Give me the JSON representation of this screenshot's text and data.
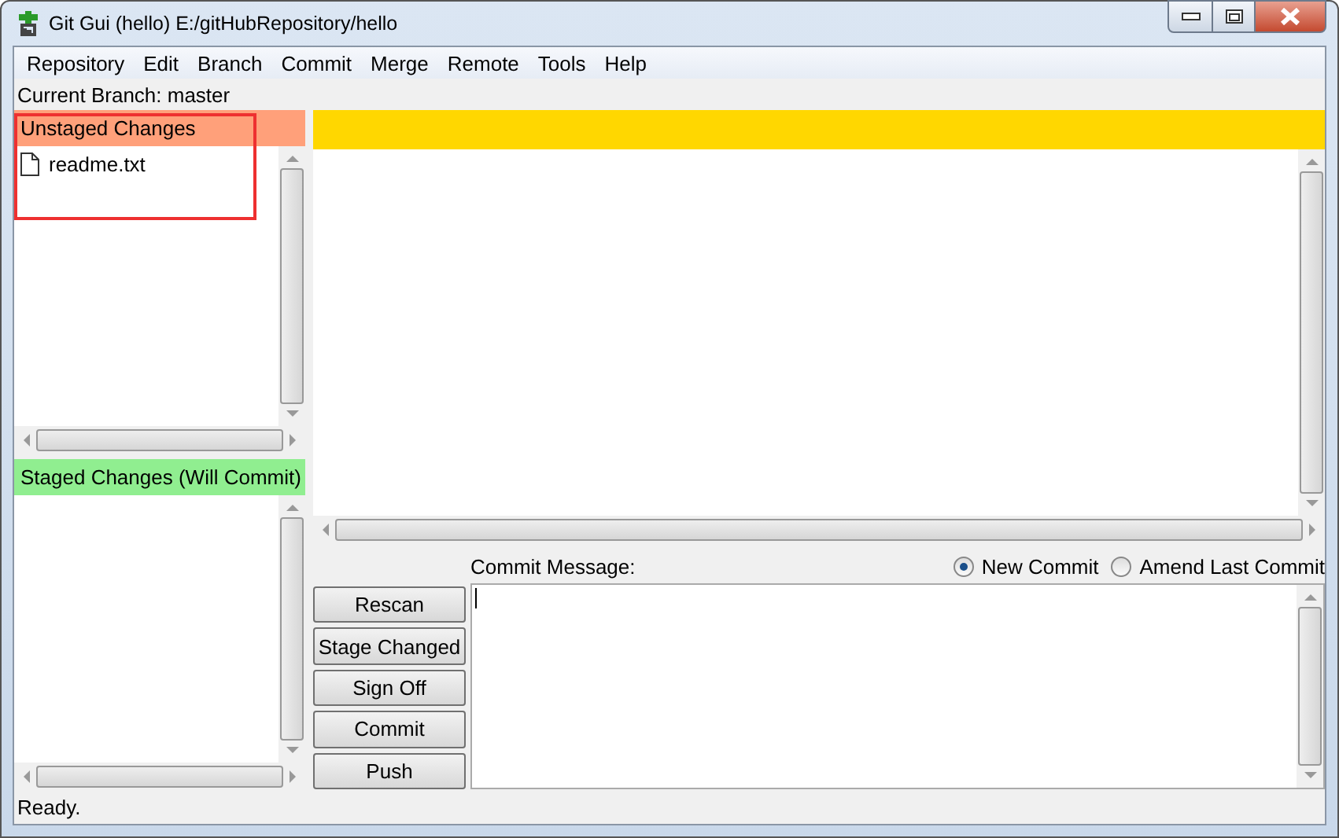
{
  "window": {
    "title": "Git Gui (hello) E:/gitHubRepository/hello"
  },
  "menu": [
    "Repository",
    "Edit",
    "Branch",
    "Commit",
    "Merge",
    "Remote",
    "Tools",
    "Help"
  ],
  "current_branch": "Current Branch: master",
  "unstaged": {
    "title": "Unstaged Changes",
    "highlighted": true,
    "files": [
      {
        "name": "readme.txt"
      }
    ]
  },
  "staged": {
    "title": "Staged Changes (Will Commit)"
  },
  "commit": {
    "label": "Commit Message:",
    "modes": [
      {
        "label": "New Commit",
        "selected": true
      },
      {
        "label": "Amend Last Commit",
        "selected": false
      }
    ],
    "buttons": [
      "Rescan",
      "Stage Changed",
      "Sign Off",
      "Commit",
      "Push"
    ]
  },
  "status_bar": "Ready."
}
